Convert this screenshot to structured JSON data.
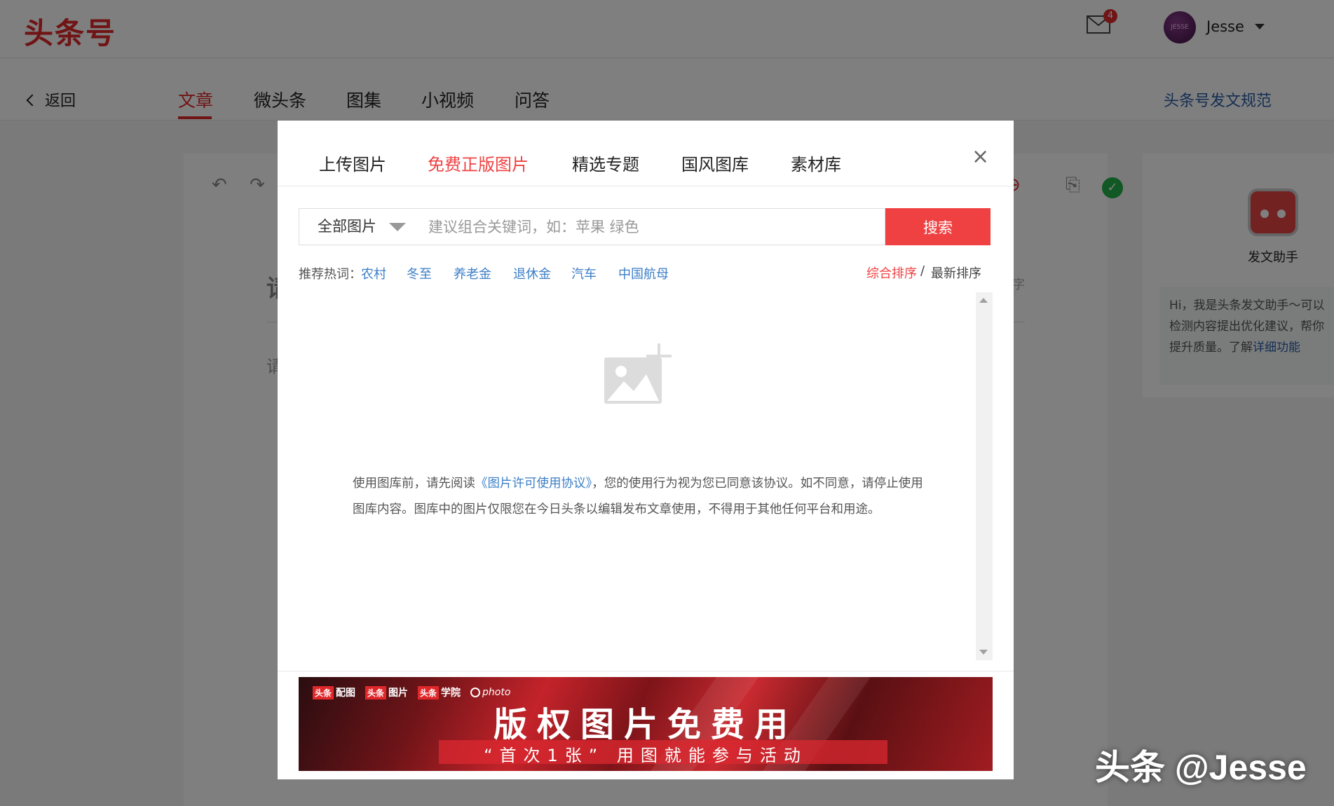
{
  "header": {
    "logo": "头条号",
    "mail_badge": "4",
    "avatar_text": "JESSE",
    "username": "Jesse"
  },
  "nav": {
    "back": "返回",
    "tabs": [
      {
        "label": "文章",
        "active": true
      },
      {
        "label": "微头条",
        "active": false
      },
      {
        "label": "图集",
        "active": false
      },
      {
        "label": "小视频",
        "active": false
      },
      {
        "label": "问答",
        "active": false
      }
    ],
    "guide_link": "头条号发文规范"
  },
  "editor": {
    "title_stub": "请",
    "body_stub": "请",
    "count_stub": "字"
  },
  "assistant": {
    "title": "发文助手",
    "text": "Hi，我是头条发文助手～可以检测内容提出优化建议，帮你提升质量。了解",
    "link": "详细功能"
  },
  "modal": {
    "tabs": [
      {
        "label": "上传图片",
        "active": false
      },
      {
        "label": "免费正版图片",
        "active": true
      },
      {
        "label": "精选专题",
        "active": false
      },
      {
        "label": "国风图库",
        "active": false
      },
      {
        "label": "素材库",
        "active": false
      }
    ],
    "close": "×",
    "filter_value": "全部图片",
    "search_placeholder": "建议组合关键词，如：苹果 绿色",
    "search_button": "搜索",
    "hot_label": "推荐热词：",
    "hot_words": [
      "农村",
      "冬至",
      "养老金",
      "退休金",
      "汽车",
      "中国航母"
    ],
    "sort_active": "综合排序",
    "sort_sep": "/",
    "sort_other": "最新排序",
    "notice_before": "使用图库前，请先阅读",
    "notice_link": "《图片许可使用协议》",
    "notice_after": "，您的使用行为视为您已同意该协议。如不同意，请停止使用图库内容。图库中的图片仅限您在今日头条以编辑发布文章使用，不得用于其他任何平台和用途。",
    "empty_icon": "image-add-icon"
  },
  "banner": {
    "brands": [
      {
        "tag": "头条",
        "name": "配图"
      },
      {
        "tag": "头条",
        "name": "图片"
      },
      {
        "tag": "头条",
        "name": "学院"
      }
    ],
    "photo_brand": "photo",
    "title": "版权图片免费用",
    "subtitle": "“首次1张” 用图就能参与活动"
  },
  "watermark": "头条 @Jesse",
  "colors": {
    "brand_red": "#e0282b",
    "accent_red": "#f04142",
    "link_blue": "#3b7ec7"
  }
}
